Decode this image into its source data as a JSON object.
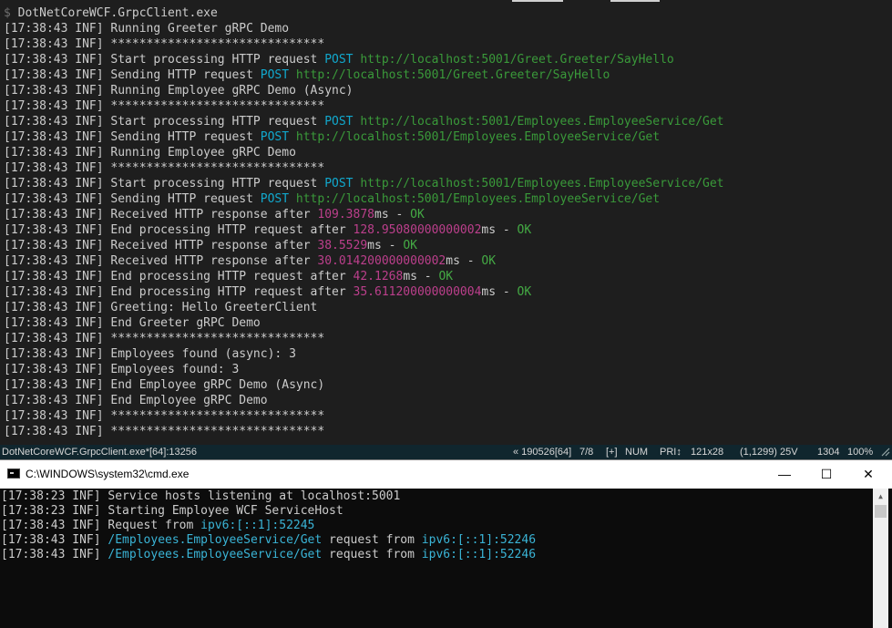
{
  "top_console": {
    "prompt_symbol": "$",
    "command": "DotNetCoreWCF.GrpcClient.exe",
    "lines": [
      [
        {
          "t": "[17:38:43 INF] Running Greeter gRPC Demo",
          "c": ""
        }
      ],
      [
        {
          "t": "[17:38:43 INF] ******************************",
          "c": ""
        }
      ],
      [
        {
          "t": "[17:38:43 INF] Start processing HTTP request ",
          "c": ""
        },
        {
          "t": "POST",
          "c": "cyan"
        },
        {
          "t": " ",
          "c": ""
        },
        {
          "t": "http://localhost:5001/Greet.Greeter/SayHello",
          "c": "green"
        }
      ],
      [
        {
          "t": "[17:38:43 INF] Sending HTTP request ",
          "c": ""
        },
        {
          "t": "POST",
          "c": "cyan"
        },
        {
          "t": " ",
          "c": ""
        },
        {
          "t": "http://localhost:5001/Greet.Greeter/SayHello",
          "c": "green"
        }
      ],
      [
        {
          "t": "[17:38:43 INF] Running Employee gRPC Demo (Async)",
          "c": ""
        }
      ],
      [
        {
          "t": "[17:38:43 INF] ******************************",
          "c": ""
        }
      ],
      [
        {
          "t": "[17:38:43 INF] Start processing HTTP request ",
          "c": ""
        },
        {
          "t": "POST",
          "c": "cyan"
        },
        {
          "t": " ",
          "c": ""
        },
        {
          "t": "http://localhost:5001/Employees.EmployeeService/Get",
          "c": "green"
        }
      ],
      [
        {
          "t": "[17:38:43 INF] Sending HTTP request ",
          "c": ""
        },
        {
          "t": "POST",
          "c": "cyan"
        },
        {
          "t": " ",
          "c": ""
        },
        {
          "t": "http://localhost:5001/Employees.EmployeeService/Get",
          "c": "green"
        }
      ],
      [
        {
          "t": "[17:38:43 INF] Running Employee gRPC Demo",
          "c": ""
        }
      ],
      [
        {
          "t": "[17:38:43 INF] ******************************",
          "c": ""
        }
      ],
      [
        {
          "t": "[17:38:43 INF] Start processing HTTP request ",
          "c": ""
        },
        {
          "t": "POST",
          "c": "cyan"
        },
        {
          "t": " ",
          "c": ""
        },
        {
          "t": "http://localhost:5001/Employees.EmployeeService/Get",
          "c": "green"
        }
      ],
      [
        {
          "t": "[17:38:43 INF] Sending HTTP request ",
          "c": ""
        },
        {
          "t": "POST",
          "c": "cyan"
        },
        {
          "t": " ",
          "c": ""
        },
        {
          "t": "http://localhost:5001/Employees.EmployeeService/Get",
          "c": "green"
        }
      ],
      [
        {
          "t": "[17:38:43 INF] Received HTTP response after ",
          "c": ""
        },
        {
          "t": "109.3878",
          "c": "mag"
        },
        {
          "t": "ms - ",
          "c": ""
        },
        {
          "t": "OK",
          "c": "ok"
        }
      ],
      [
        {
          "t": "[17:38:43 INF] End processing HTTP request after ",
          "c": ""
        },
        {
          "t": "128.95080000000002",
          "c": "mag"
        },
        {
          "t": "ms - ",
          "c": ""
        },
        {
          "t": "OK",
          "c": "ok"
        }
      ],
      [
        {
          "t": "[17:38:43 INF] Received HTTP response after ",
          "c": ""
        },
        {
          "t": "38.5529",
          "c": "mag"
        },
        {
          "t": "ms - ",
          "c": ""
        },
        {
          "t": "OK",
          "c": "ok"
        }
      ],
      [
        {
          "t": "[17:38:43 INF] Received HTTP response after ",
          "c": ""
        },
        {
          "t": "30.014200000000002",
          "c": "mag"
        },
        {
          "t": "ms - ",
          "c": ""
        },
        {
          "t": "OK",
          "c": "ok"
        }
      ],
      [
        {
          "t": "[17:38:43 INF] End processing HTTP request after ",
          "c": ""
        },
        {
          "t": "42.1268",
          "c": "mag"
        },
        {
          "t": "ms - ",
          "c": ""
        },
        {
          "t": "OK",
          "c": "ok"
        }
      ],
      [
        {
          "t": "[17:38:43 INF] End processing HTTP request after ",
          "c": ""
        },
        {
          "t": "35.611200000000004",
          "c": "mag"
        },
        {
          "t": "ms - ",
          "c": ""
        },
        {
          "t": "OK",
          "c": "ok"
        }
      ],
      [
        {
          "t": "[17:38:43 INF] Greeting: Hello GreeterClient",
          "c": ""
        }
      ],
      [
        {
          "t": "[17:38:43 INF] End Greeter gRPC Demo",
          "c": ""
        }
      ],
      [
        {
          "t": "[17:38:43 INF] ******************************",
          "c": ""
        }
      ],
      [
        {
          "t": "[17:38:43 INF] Employees found (async): 3",
          "c": ""
        }
      ],
      [
        {
          "t": "[17:38:43 INF] Employees found: 3",
          "c": ""
        }
      ],
      [
        {
          "t": "[17:38:43 INF] End Employee gRPC Demo (Async)",
          "c": ""
        }
      ],
      [
        {
          "t": "[17:38:43 INF] End Employee gRPC Demo",
          "c": ""
        }
      ],
      [
        {
          "t": "[17:38:43 INF] ******************************",
          "c": ""
        }
      ],
      [
        {
          "t": "[17:38:43 INF] ******************************",
          "c": ""
        }
      ]
    ]
  },
  "status_bar": {
    "process": "DotNetCoreWCF.GrpcClient.exe*[64]:13256",
    "buffer": "« 190526[64]",
    "tab": "7/8",
    "insert": "[+]",
    "num": "NUM",
    "pri": "PRI↕",
    "size": "121x28",
    "cursor": "(1,1299) 25V",
    "count": "1304",
    "zoom": "100%"
  },
  "cmd_window": {
    "title": "C:\\WINDOWS\\system32\\cmd.exe",
    "minimize": "—",
    "maximize": "☐",
    "close": "✕",
    "lines": [
      [
        {
          "t": "[17:38:23 INF] Service hosts listening at localhost:5001",
          "c": ""
        }
      ],
      [
        {
          "t": "[17:38:23 INF] Starting Employee WCF ServiceHost",
          "c": ""
        }
      ],
      [
        {
          "t": "[17:38:43 INF] Request from ",
          "c": ""
        },
        {
          "t": "ipv6:[::1]:52245",
          "c": "cc"
        }
      ],
      [
        {
          "t": "[17:38:43 INF] ",
          "c": ""
        },
        {
          "t": "/Employees.EmployeeService/Get",
          "c": "cc"
        },
        {
          "t": " request from ",
          "c": ""
        },
        {
          "t": "ipv6:[::1]:52246",
          "c": "cc"
        }
      ],
      [
        {
          "t": "[17:38:43 INF] ",
          "c": ""
        },
        {
          "t": "/Employees.EmployeeService/Get",
          "c": "cc"
        },
        {
          "t": " request from ",
          "c": ""
        },
        {
          "t": "ipv6:[::1]:52246",
          "c": "cc"
        }
      ]
    ]
  },
  "colors": {
    "console_bg": "#1e1e1e",
    "cmd_bg": "#0c0c0c",
    "status_bg": "#10262e",
    "cyan": "#11a8cd",
    "green": "#3a9a3a",
    "magenta": "#bc3f8c"
  }
}
